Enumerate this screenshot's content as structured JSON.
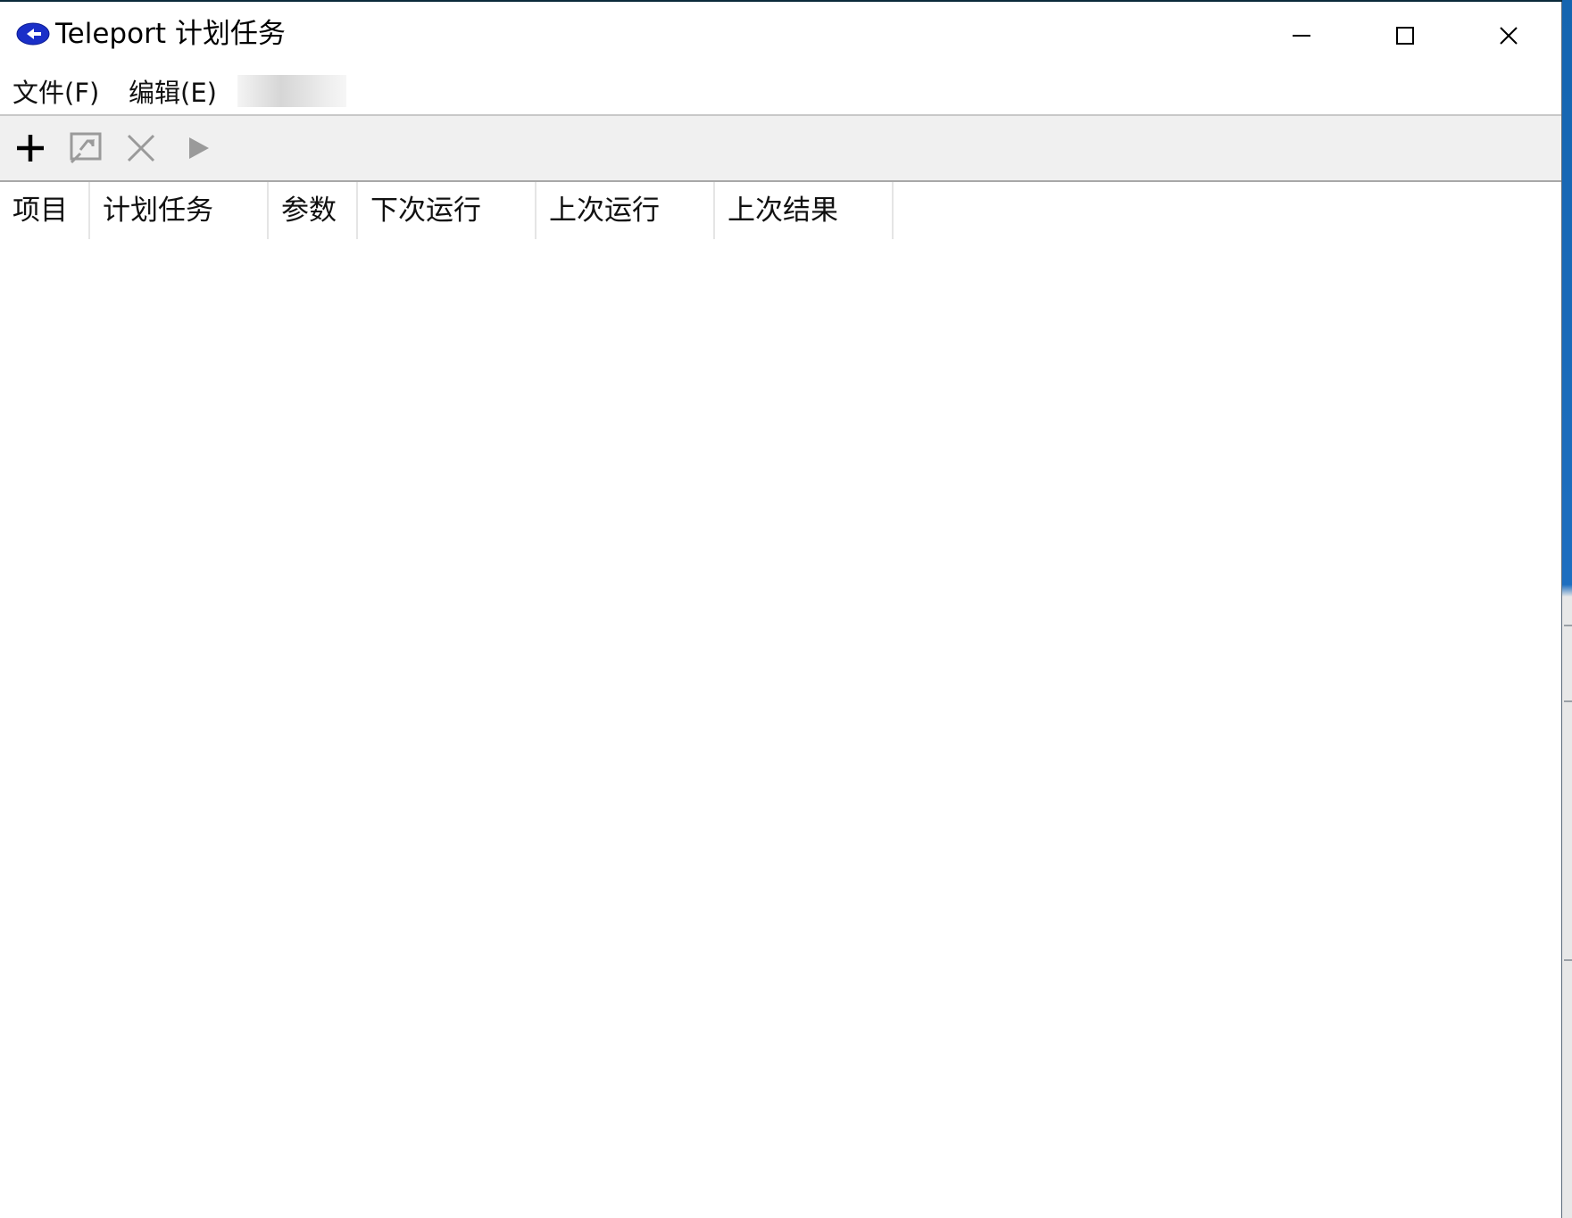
{
  "window": {
    "title": "Teleport 计划任务",
    "icon": "teleport-app-icon"
  },
  "window_controls": {
    "minimize_icon": "minimize-icon",
    "maximize_icon": "maximize-icon",
    "close_icon": "close-icon"
  },
  "menubar": {
    "items": [
      {
        "label": "文件(F)"
      },
      {
        "label": "编辑(E)"
      }
    ]
  },
  "toolbar": {
    "buttons": [
      {
        "icon": "add-icon",
        "enabled": true
      },
      {
        "icon": "edit-icon",
        "enabled": false
      },
      {
        "icon": "delete-icon",
        "enabled": false
      },
      {
        "icon": "run-icon",
        "enabled": false
      }
    ]
  },
  "table": {
    "columns": [
      {
        "label": "项目"
      },
      {
        "label": "计划任务"
      },
      {
        "label": "参数"
      },
      {
        "label": "下次运行"
      },
      {
        "label": "上次运行"
      },
      {
        "label": "上次结果"
      }
    ],
    "rows": []
  },
  "colors": {
    "app_icon_blue": "#1a2fc8",
    "toolbar_bg": "#f0f0f0",
    "disabled_icon": "#9a9a9a"
  }
}
